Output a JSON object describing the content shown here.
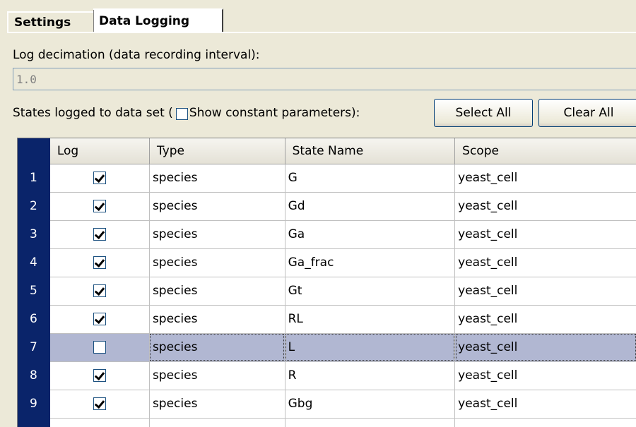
{
  "tabs": [
    {
      "label": "Settings"
    },
    {
      "label": "Data Logging"
    }
  ],
  "decimation": {
    "label": "Log decimation (data recording interval):",
    "value": "1.0"
  },
  "states": {
    "label_prefix": "States logged to data set (",
    "show_constant_label": "Show constant parameters):",
    "show_constant_checked": false,
    "select_all_label": "Select All",
    "clear_all_label": "Clear All"
  },
  "table": {
    "columns": [
      "Log",
      "Type",
      "State Name",
      "Scope"
    ],
    "rows": [
      {
        "num": "1",
        "log": true,
        "type": "species",
        "name": "G",
        "scope": "yeast_cell"
      },
      {
        "num": "2",
        "log": true,
        "type": "species",
        "name": "Gd",
        "scope": "yeast_cell"
      },
      {
        "num": "3",
        "log": true,
        "type": "species",
        "name": "Ga",
        "scope": "yeast_cell"
      },
      {
        "num": "4",
        "log": true,
        "type": "species",
        "name": "Ga_frac",
        "scope": "yeast_cell"
      },
      {
        "num": "5",
        "log": true,
        "type": "species",
        "name": "Gt",
        "scope": "yeast_cell"
      },
      {
        "num": "6",
        "log": true,
        "type": "species",
        "name": "RL",
        "scope": "yeast_cell"
      },
      {
        "num": "7",
        "log": false,
        "type": "species",
        "name": "L",
        "scope": "yeast_cell",
        "selected": true
      },
      {
        "num": "8",
        "log": true,
        "type": "species",
        "name": "R",
        "scope": "yeast_cell"
      },
      {
        "num": "9",
        "log": true,
        "type": "species",
        "name": "Gbg",
        "scope": "yeast_cell"
      }
    ]
  }
}
